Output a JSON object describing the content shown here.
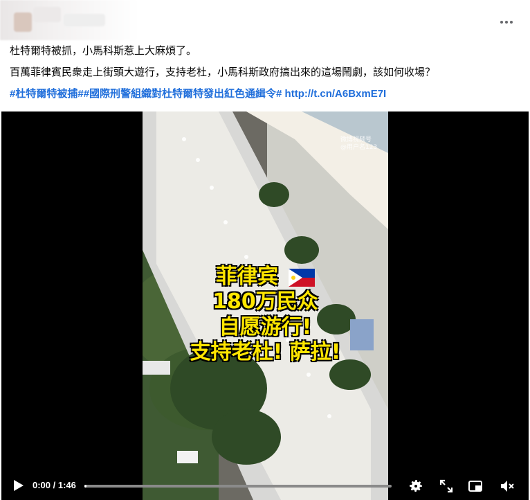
{
  "post": {
    "line1": "杜特爾特被抓，小馬科斯惹上大麻煩了。",
    "line2": "百萬菲律賓民衆走上街頭大遊行，支持老杜，小馬科斯政府搞出來的這場鬧劇，該如何收場？",
    "hashtag1": "#杜特爾特被捕#",
    "hashtag2": "#國際刑警組織對杜特爾特發出紅色通緝令#",
    "link": "http://t.cn/A6BxmE7I"
  },
  "video": {
    "overlay": {
      "line1": "菲律宾",
      "line2": "180万民众",
      "line3": "自愿游行!",
      "line4": "支持老杜! 萨拉!"
    },
    "watermark": {
      "line1": "微博视频号",
      "line2": "@用户名123"
    },
    "time": "0:00 / 1:46",
    "progress": 0.0
  },
  "icons": {
    "more": "more-horizontal-icon",
    "play": "play-icon",
    "settings": "gear-icon",
    "fullscreen": "expand-icon",
    "pip": "picture-in-picture-icon",
    "volume": "volume-muted-icon"
  }
}
